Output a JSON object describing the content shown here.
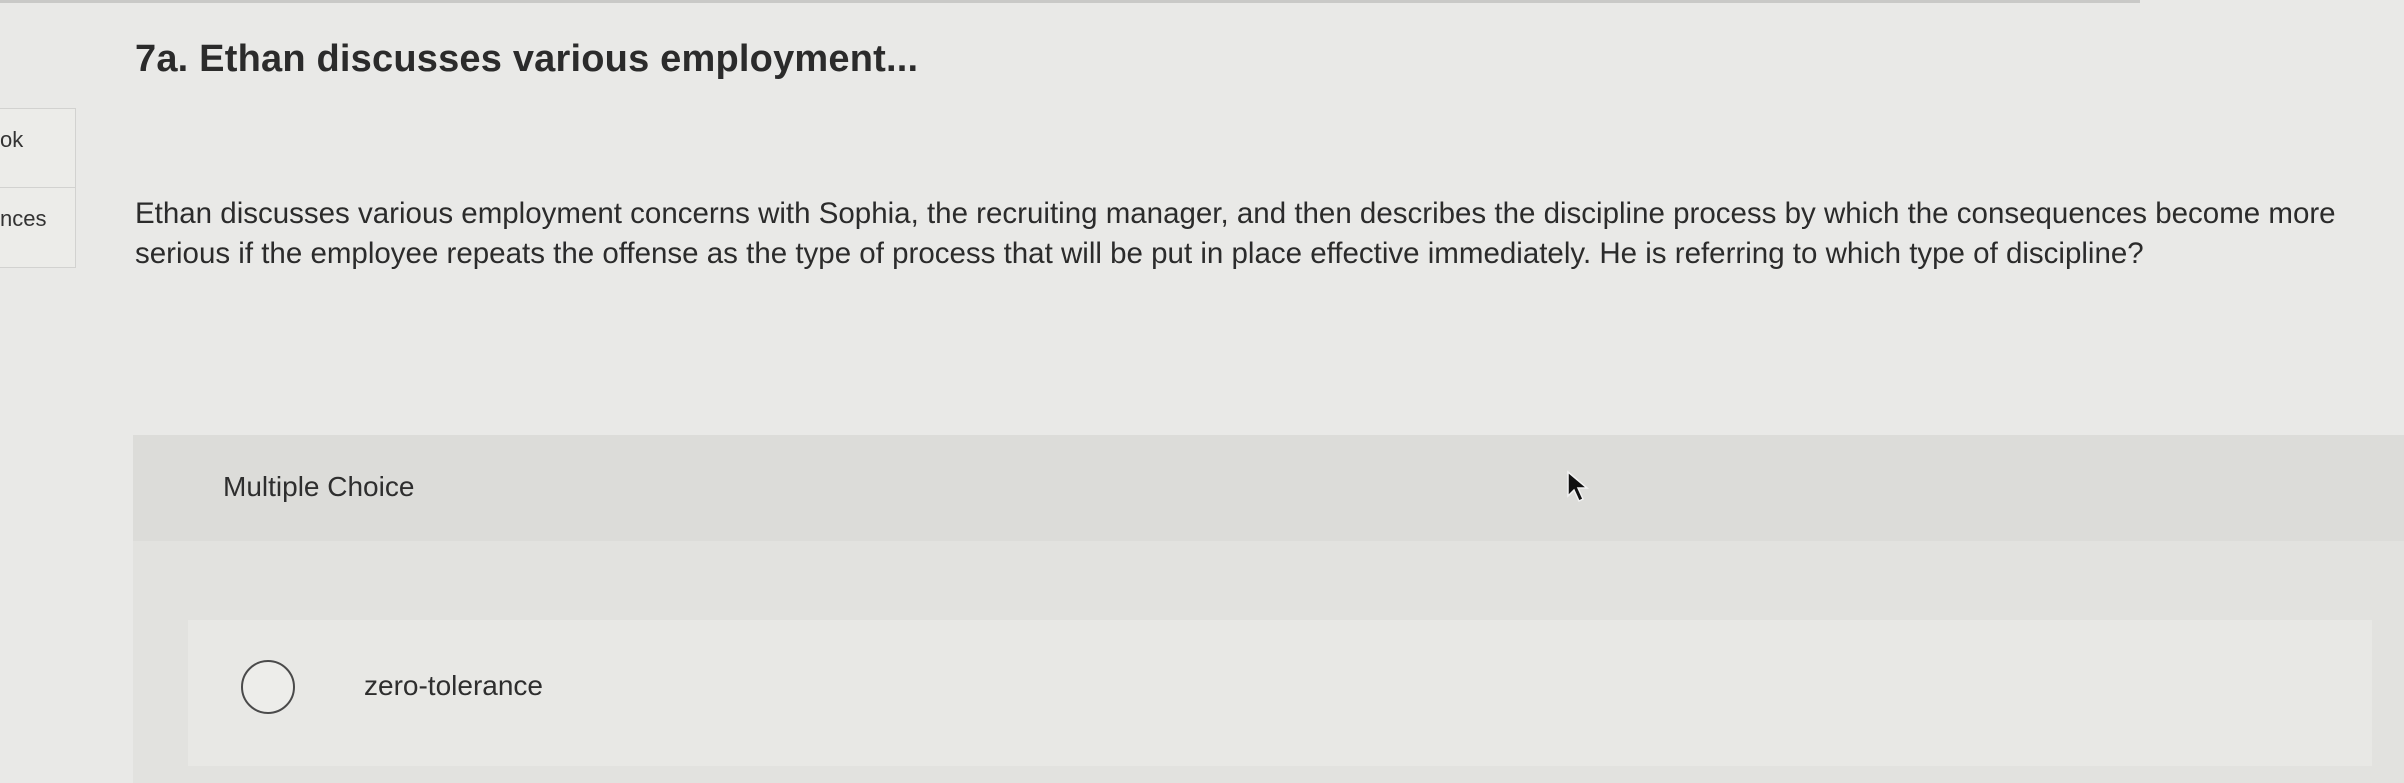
{
  "sidebar": {
    "tabs": [
      {
        "label": "ok"
      },
      {
        "label": "nces"
      }
    ]
  },
  "question": {
    "title": "7a. Ethan discusses various employment...",
    "text": "Ethan discusses various employment concerns with Sophia, the recruiting manager, and then describes the discipline process by which the consequences become more serious if the employee repeats the offense as the type of process that will be put in place effective immediately. He is referring to which type of discipline?"
  },
  "answers": {
    "header": "Multiple Choice",
    "options": [
      {
        "label": "zero-tolerance",
        "selected": false
      }
    ]
  },
  "icons": {
    "radio": "radio-button-icon",
    "cursor": "mouse-pointer-icon"
  }
}
